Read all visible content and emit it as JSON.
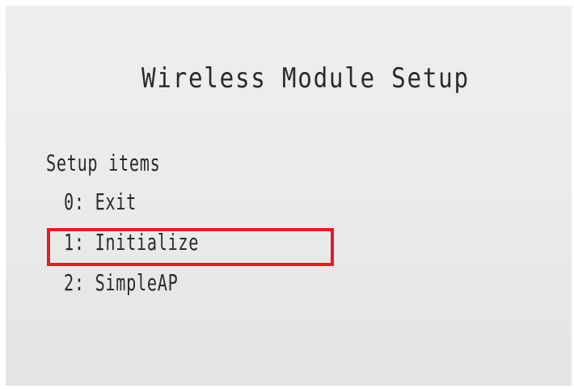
{
  "title": "Wireless Module Setup",
  "section_heading": "Setup items",
  "items": [
    {
      "label": "0: Exit"
    },
    {
      "label": "1: Initialize"
    },
    {
      "label": "2: SimpleAP"
    }
  ],
  "highlight": {
    "item_index": 1,
    "color": "#e11d25"
  },
  "colors": {
    "paper": "#e9ebea",
    "ink": "#2a2a2a"
  }
}
